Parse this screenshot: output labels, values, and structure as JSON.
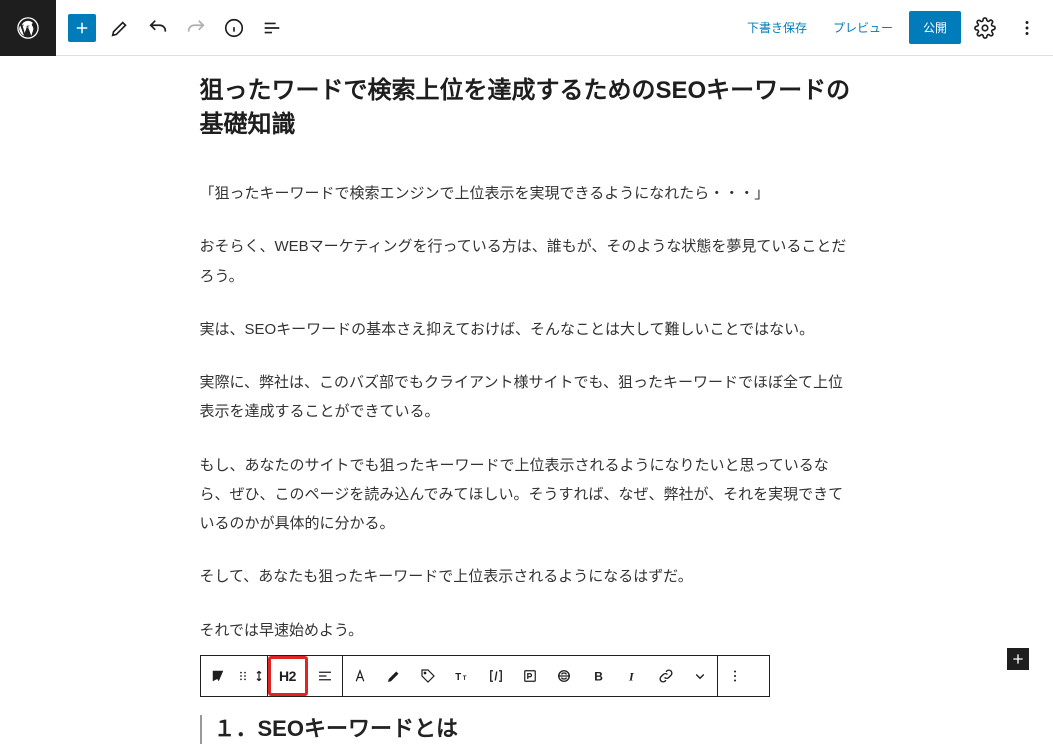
{
  "header": {
    "save_draft": "下書き保存",
    "preview": "プレビュー",
    "publish": "公開"
  },
  "post": {
    "title": "狙ったワードで検索上位を達成するためのSEOキーワードの基礎知識",
    "paragraphs": [
      "「狙ったキーワードで検索エンジンで上位表示を実現できるようになれたら・・・」",
      "おそらく、WEBマーケティングを行っている方は、誰もが、そのような状態を夢見ていることだろう。",
      "実は、SEOキーワードの基本さえ抑えておけば、そんなことは大して難しいことではない。",
      "実際に、弊社は、このバズ部でもクライアント様サイトでも、狙ったキーワードでほぼ全て上位表示を達成することができている。",
      "もし、あなたのサイトでも狙ったキーワードで上位表示されるようになりたいと思っているなら、ぜひ、このページを読み込んでみてほしい。そうすれば、なぜ、弊社が、それを実現できているのかが具体的に分かる。",
      "そして、あなたも狙ったキーワードで上位表示されるようになるはずだ。",
      "それでは早速始めよう。"
    ],
    "heading_block": "１．SEOキーワードとは"
  },
  "toolbar": {
    "heading_level": "H2"
  }
}
